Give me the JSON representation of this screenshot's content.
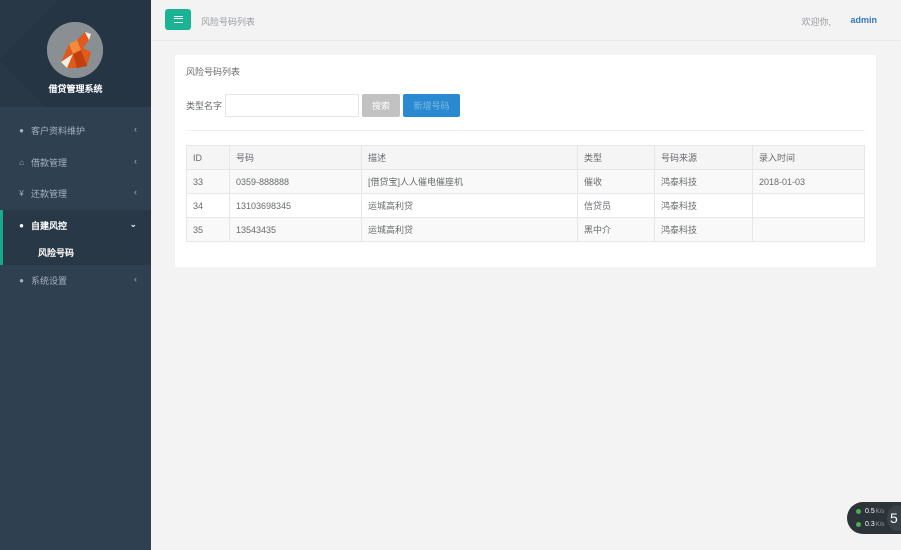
{
  "sidebar": {
    "brand": "借贷管理系统",
    "menu": [
      {
        "label": "客户资料维护",
        "icon": "user-icon",
        "glyph": "●",
        "arrow": "‹"
      },
      {
        "label": "借款管理",
        "icon": "home-icon",
        "glyph": "⌂",
        "arrow": "‹"
      },
      {
        "label": "还款管理",
        "icon": "yen-icon",
        "glyph": "¥",
        "arrow": "‹"
      },
      {
        "label": "自建风控",
        "icon": "user-icon",
        "glyph": "●",
        "arrow": "⌄",
        "submenu": [
          {
            "label": "风险号码"
          }
        ]
      },
      {
        "label": "系统设置",
        "icon": "user-icon",
        "glyph": "●",
        "arrow": "‹"
      }
    ]
  },
  "topbar": {
    "breadcrumb": "风险号码列表",
    "welcome": "欢迎你,",
    "username": "admin"
  },
  "panel": {
    "title": "风险号码列表",
    "search_label": "类型名字",
    "search_value": "",
    "search_button": "搜索",
    "add_button": "新增号码"
  },
  "table": {
    "columns": [
      "ID",
      "号码",
      "描述",
      "类型",
      "号码来源",
      "录入时间"
    ],
    "rows": [
      [
        "33",
        "0359-888888",
        "[借贷宝]人人催电催座机",
        "催收",
        "鸿泰科技",
        "2018-01-03"
      ],
      [
        "34",
        "13103698345",
        "运城高利贷",
        "信贷员",
        "鸿泰科技",
        ""
      ],
      [
        "35",
        "13543435",
        "运城高利贷",
        "黑中介",
        "鸿泰科技",
        ""
      ]
    ]
  },
  "net_widget": {
    "upload": "0.5",
    "download": "0.3",
    "unit": "K/s",
    "badge": "5",
    "up_color": "#4caf50",
    "down_color": "#4caf50"
  },
  "colors": {
    "sidebar_bg": "#2f4050",
    "accent": "#1ab394",
    "primary_button": "#2a8ad1",
    "link": "#337ab7"
  }
}
